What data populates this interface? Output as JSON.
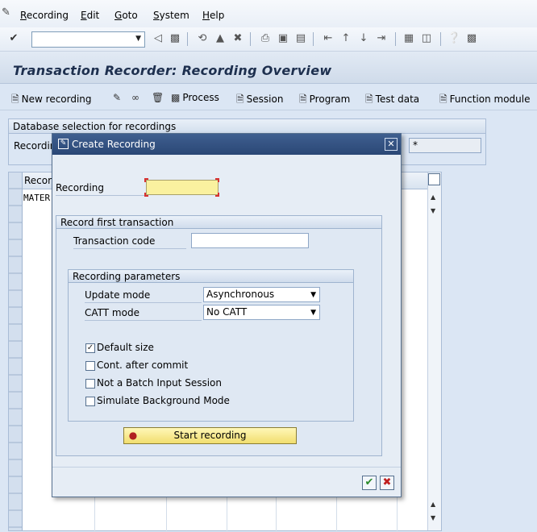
{
  "menu": {
    "items": [
      "Recording",
      "Edit",
      "Goto",
      "System",
      "Help"
    ]
  },
  "toolbar": {
    "command_field_value": ""
  },
  "title_bar": {
    "title": "Transaction Recorder: Recording Overview"
  },
  "app_toolbar": {
    "new_recording": "New recording",
    "process": "Process",
    "session": "Session",
    "program": "Program",
    "test_data": "Test data",
    "function_module": "Function module"
  },
  "db_selection": {
    "header": "Database selection for recordings",
    "label": "Recordin",
    "value": "*"
  },
  "recordings_table": {
    "header": "Recor",
    "first_cell": "MATER"
  },
  "dialog": {
    "title": "Create Recording",
    "recording_label": "Recording",
    "recording_value": "",
    "first_transaction": {
      "header": "Record first transaction",
      "transaction_code_label": "Transaction code",
      "transaction_code_value": ""
    },
    "parameters": {
      "header": "Recording parameters",
      "update_mode_label": "Update mode",
      "update_mode_value": "Asynchronous",
      "catt_mode_label": "CATT mode",
      "catt_mode_value": "No CATT",
      "checkboxes": [
        {
          "label": "Default size",
          "checked": true
        },
        {
          "label": "Cont. after commit",
          "checked": false
        },
        {
          "label": "Not a Batch Input Session",
          "checked": false
        },
        {
          "label": "Simulate Background Mode",
          "checked": false
        }
      ]
    },
    "start_button": "Start recording"
  }
}
